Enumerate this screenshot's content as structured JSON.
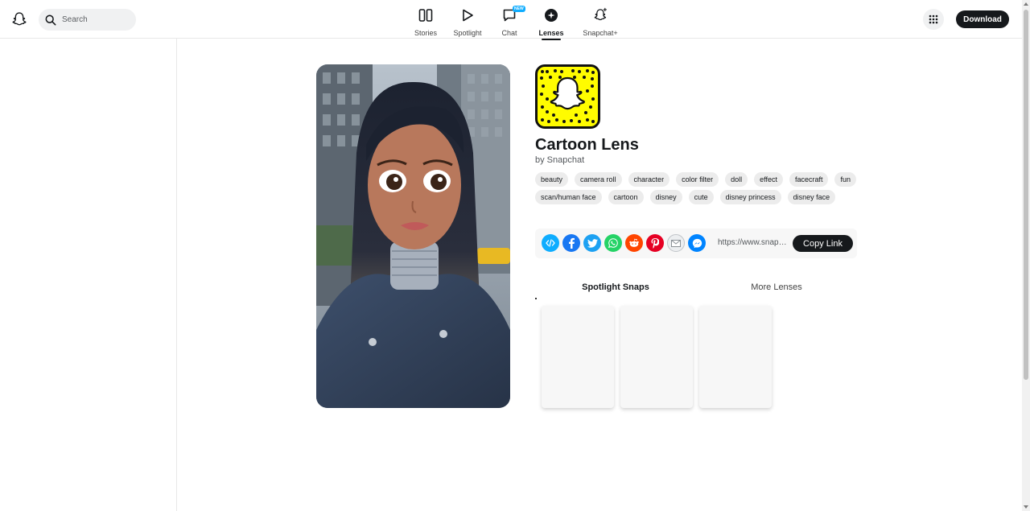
{
  "header": {
    "search_placeholder": "Search",
    "nav": [
      {
        "label": "Stories",
        "icon": "stories-icon"
      },
      {
        "label": "Spotlight",
        "icon": "play-icon"
      },
      {
        "label": "Chat",
        "icon": "chat-icon",
        "badge": "NEW"
      },
      {
        "label": "Lenses",
        "icon": "lens-icon",
        "active": true
      },
      {
        "label": "Snapchat+",
        "icon": "ghost-plus-icon"
      }
    ],
    "download_label": "Download"
  },
  "lens": {
    "title": "Cartoon Lens",
    "creator": "by Snapchat",
    "tags": [
      "beauty",
      "camera roll",
      "character",
      "color filter",
      "doll",
      "effect",
      "facecraft",
      "fun",
      "scan/human face",
      "cartoon",
      "disney",
      "cute",
      "disney princess",
      "disney face"
    ]
  },
  "share": {
    "icons": [
      "embed-icon",
      "facebook-icon",
      "twitter-icon",
      "whatsapp-icon",
      "reddit-icon",
      "pinterest-icon",
      "email-icon",
      "messenger-icon"
    ],
    "url": "https://www.snapchat.com/lens/...",
    "copy_label": "Copy Link"
  },
  "tabs": [
    {
      "label": "Spotlight Snaps",
      "active": true
    },
    {
      "label": "More Lenses",
      "active": false
    }
  ],
  "colors": {
    "snapcode_yellow": "#fffc00",
    "dark": "#16191c",
    "badge_blue": "#0fadff"
  }
}
